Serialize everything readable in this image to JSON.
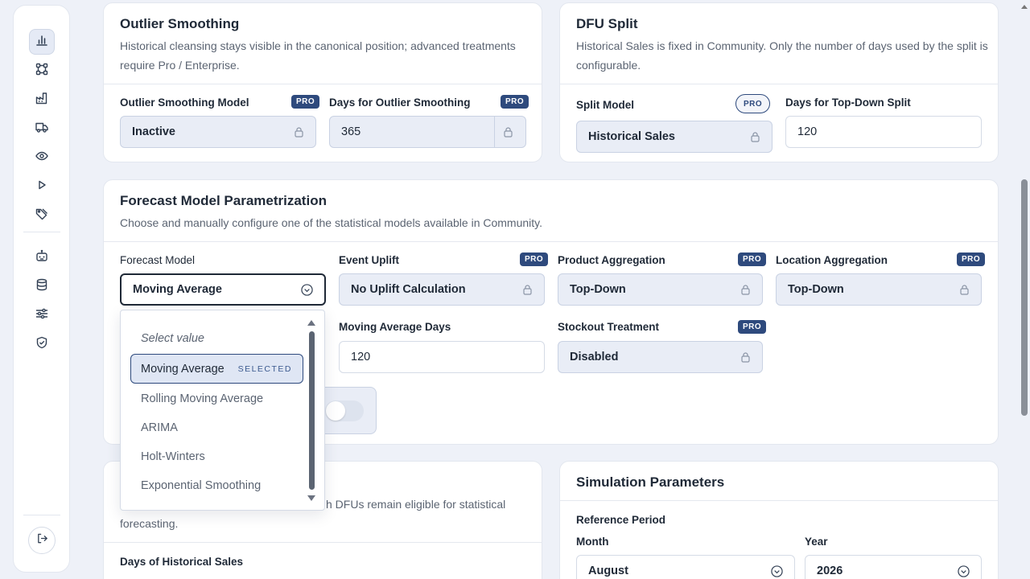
{
  "sidebar": {
    "items": [
      {
        "icon": "bar-chart-icon",
        "active": true
      },
      {
        "icon": "workflow-icon",
        "active": false
      },
      {
        "icon": "factory-icon",
        "active": false
      },
      {
        "icon": "truck-icon",
        "active": false
      },
      {
        "icon": "eye-icon",
        "active": false
      },
      {
        "icon": "play-icon",
        "active": false
      },
      {
        "icon": "tag-icon",
        "active": false
      },
      {
        "icon": "robot-icon",
        "active": false
      },
      {
        "icon": "database-icon",
        "active": false
      },
      {
        "icon": "sliders-icon",
        "active": false
      },
      {
        "icon": "shield-check-icon",
        "active": false
      }
    ],
    "logout_icon": "logout-icon"
  },
  "outlier": {
    "title": "Outlier Smoothing",
    "desc": "Historical cleansing stays visible in the canonical position; advanced treatments require Pro / Enterprise.",
    "model_label": "Outlier Smoothing Model",
    "model_value": "Inactive",
    "days_label": "Days for Outlier Smoothing",
    "days_value": "365",
    "pro": "PRO"
  },
  "dfu": {
    "title": "DFU Split",
    "desc": "Historical Sales is fixed in Community. Only the number of days used by the split is configurable.",
    "split_label": "Split Model",
    "split_value": "Historical Sales",
    "days_label": "Days for Top-Down Split",
    "days_value": "120",
    "pro": "PRO"
  },
  "forecast": {
    "title": "Forecast Model Parametrization",
    "desc": "Choose and manually configure one of the statistical models available in Community.",
    "model_label": "Forecast Model",
    "model_value": "Moving Average",
    "uplift_label": "Event Uplift",
    "uplift_value": "No Uplift Calculation",
    "product_label": "Product Aggregation",
    "product_value": "Top-Down",
    "location_label": "Location Aggregation",
    "location_value": "Top-Down",
    "ma_days_label": "Moving Average Days",
    "ma_days_value": "120",
    "stockout_label": "Stockout Treatment",
    "stockout_value": "Disabled",
    "pro": "PRO",
    "toggle_on": false
  },
  "dropdown": {
    "placeholder": "Select value",
    "selected": "Moving Average",
    "selected_tag": "SELECTED",
    "options": [
      "Rolling Moving Average",
      "ARIMA",
      "Holt-Winters",
      "Exponential Smoothing"
    ]
  },
  "history": {
    "desc_line1": "h DFUs remain eligible for statistical",
    "desc_line2": "forecasting.",
    "days_label": "Days of Historical Sales"
  },
  "simulation": {
    "title": "Simulation Parameters",
    "ref_label": "Reference Period",
    "month_label": "Month",
    "month_value": "August",
    "year_label": "Year",
    "year_value": "2026"
  }
}
